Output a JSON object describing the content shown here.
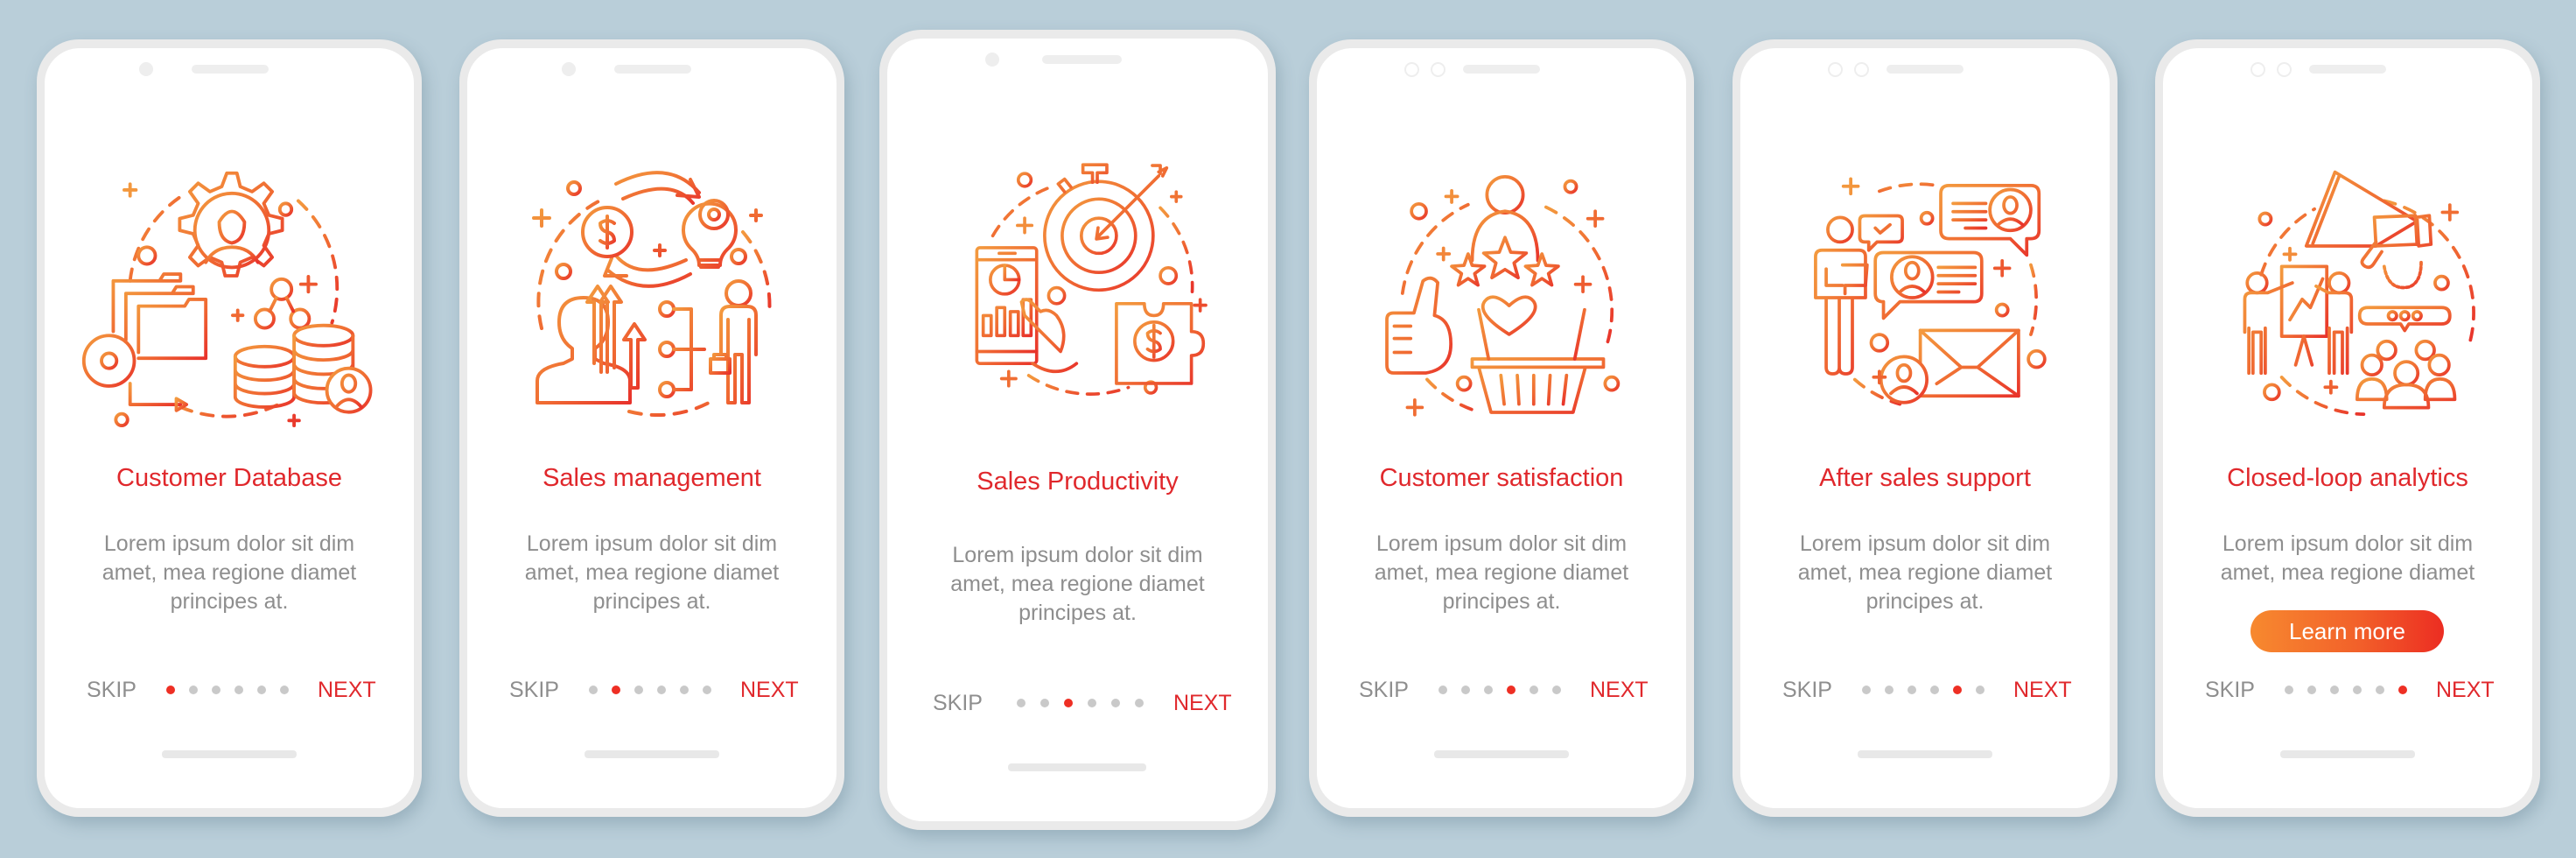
{
  "colors": {
    "background": "#B9CED9",
    "accent_red": "#E0282C",
    "icon_gradient_start": "#F39A3E",
    "icon_gradient_end": "#E8322B",
    "body_text": "#8E8E8E",
    "dot_inactive": "#C9C9C9",
    "dot_active": "#EE2F24",
    "button_gradient_start": "#F7892F",
    "button_gradient_end": "#EC2D22"
  },
  "screens": [
    {
      "illustration": "customer-database-illustration",
      "title": "Customer Database",
      "body_lines": [
        "Lorem ipsum dolor sit dim",
        "amet, mea regione diamet",
        "principes at."
      ],
      "skip_label": "SKIP",
      "next_label": "NEXT",
      "page_count": 6,
      "active_page": 1
    },
    {
      "illustration": "sales-management-illustration",
      "title": "Sales management",
      "body_lines": [
        "Lorem ipsum dolor sit dim",
        "amet, mea regione diamet",
        "principes at."
      ],
      "skip_label": "SKIP",
      "next_label": "NEXT",
      "page_count": 6,
      "active_page": 2
    },
    {
      "illustration": "sales-productivity-illustration",
      "title": "Sales Productivity",
      "body_lines": [
        "Lorem ipsum dolor sit dim",
        "amet, mea regione diamet",
        "principes at."
      ],
      "skip_label": "SKIP",
      "next_label": "NEXT",
      "page_count": 6,
      "active_page": 3
    },
    {
      "illustration": "customer-satisfaction-illustration",
      "title": "Customer satisfaction",
      "body_lines": [
        "Lorem ipsum dolor sit dim",
        "amet, mea regione diamet",
        "principes at."
      ],
      "skip_label": "SKIP",
      "next_label": "NEXT",
      "page_count": 6,
      "active_page": 4
    },
    {
      "illustration": "after-sales-support-illustration",
      "title": "After sales support",
      "body_lines": [
        "Lorem ipsum dolor sit dim",
        "amet, mea regione diamet",
        "principes at."
      ],
      "skip_label": "SKIP",
      "next_label": "NEXT",
      "page_count": 6,
      "active_page": 5
    },
    {
      "illustration": "closed-loop-analytics-illustration",
      "title": "Closed-loop analytics",
      "body_lines": [
        "Lorem ipsum dolor sit dim",
        "amet, mea regione diamet"
      ],
      "button_label": "Learn more",
      "skip_label": "SKIP",
      "next_label": "NEXT",
      "page_count": 6,
      "active_page": 6
    }
  ]
}
